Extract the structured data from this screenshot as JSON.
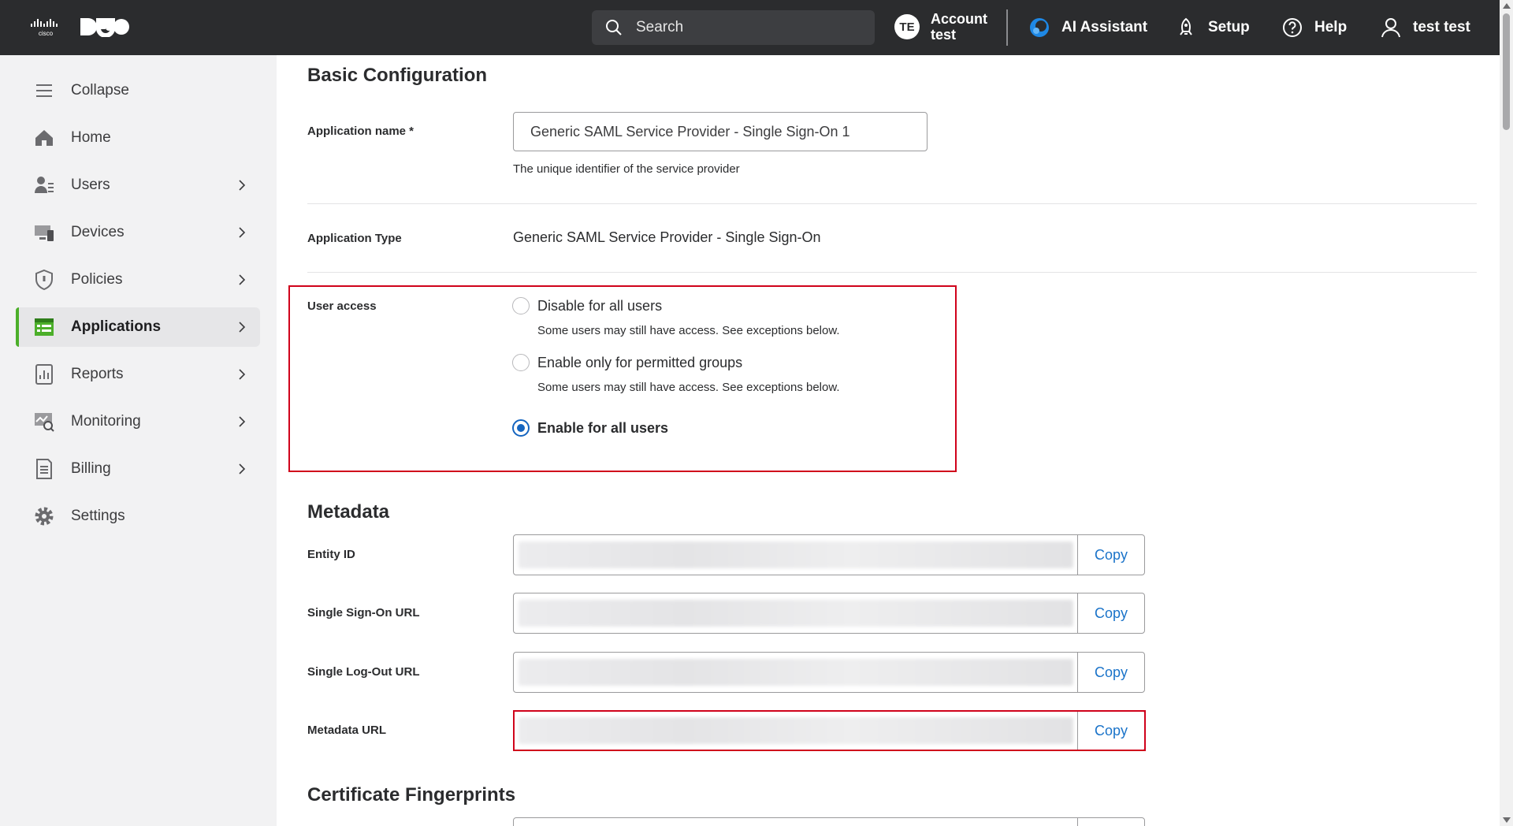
{
  "header": {
    "search_placeholder": "Search",
    "account_initials": "TE",
    "account_line1": "Account",
    "account_line2": "test",
    "ai_assistant": "AI Assistant",
    "setup": "Setup",
    "help": "Help",
    "user": "test test"
  },
  "sidebar": {
    "items": [
      {
        "label": "Collapse",
        "icon": "menu-icon",
        "chevron": false
      },
      {
        "label": "Home",
        "icon": "home-icon",
        "chevron": false
      },
      {
        "label": "Users",
        "icon": "users-icon",
        "chevron": true
      },
      {
        "label": "Devices",
        "icon": "devices-icon",
        "chevron": true
      },
      {
        "label": "Policies",
        "icon": "shield-icon",
        "chevron": true
      },
      {
        "label": "Applications",
        "icon": "applications-icon",
        "chevron": true,
        "active": true
      },
      {
        "label": "Reports",
        "icon": "reports-icon",
        "chevron": true
      },
      {
        "label": "Monitoring",
        "icon": "monitoring-icon",
        "chevron": true
      },
      {
        "label": "Billing",
        "icon": "billing-icon",
        "chevron": true
      },
      {
        "label": "Settings",
        "icon": "gear-icon",
        "chevron": false
      }
    ]
  },
  "basic": {
    "title": "Basic Configuration",
    "app_name_label": "Application name *",
    "app_name_value": "Generic SAML Service Provider - Single Sign-On 1",
    "app_name_help": "The unique identifier of the service provider",
    "app_type_label": "Application Type",
    "app_type_value": "Generic SAML Service Provider - Single Sign-On"
  },
  "user_access": {
    "label": "User access",
    "options": [
      {
        "label": "Disable for all users",
        "help": "Some users may still have access. See exceptions below.",
        "selected": false
      },
      {
        "label": "Enable only for permitted groups",
        "help": "Some users may still have access. See exceptions below.",
        "selected": false
      },
      {
        "label": "Enable for all users",
        "help": "",
        "selected": true
      }
    ]
  },
  "metadata": {
    "title": "Metadata",
    "copy_label": "Copy",
    "fields": [
      {
        "label": "Entity ID"
      },
      {
        "label": "Single Sign-On URL"
      },
      {
        "label": "Single Log-Out URL"
      },
      {
        "label": "Metadata URL"
      }
    ]
  },
  "certificate": {
    "title": "Certificate Fingerprints"
  },
  "colors": {
    "topbar": "#2b2c2e",
    "accent_green": "#4caf2a",
    "link_blue": "#1a73c9",
    "highlight_red": "#d0021b",
    "radio_blue": "#1565c0"
  }
}
